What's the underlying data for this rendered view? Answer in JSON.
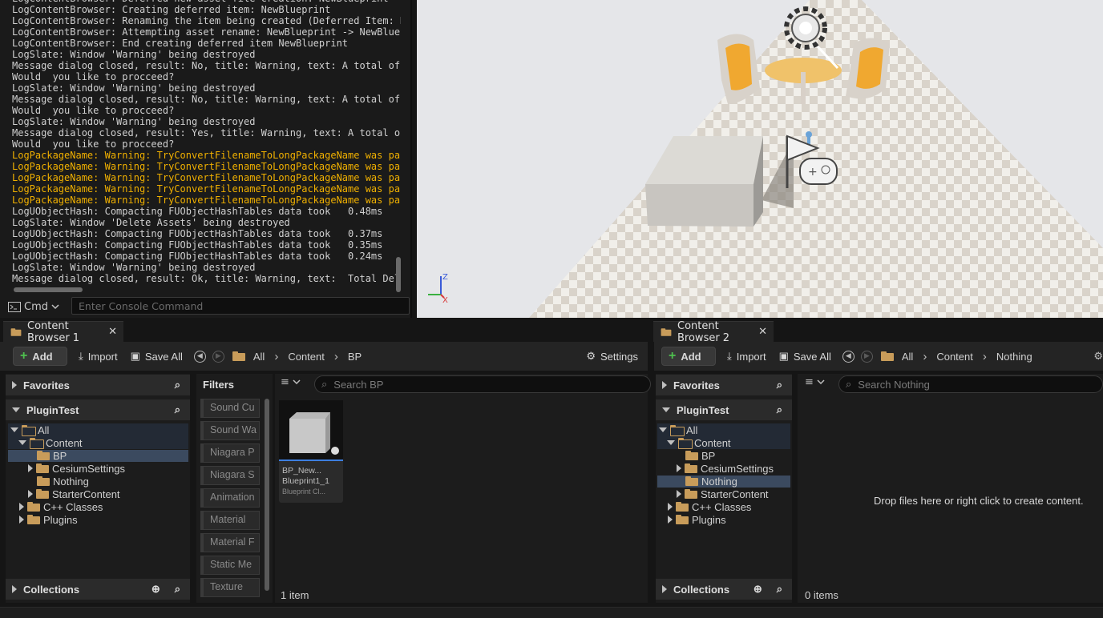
{
  "log": {
    "lines": [
      {
        "text": "LogContentBrowser: Deferred new asset file creation: NewBlueprint",
        "warn": false
      },
      {
        "text": "LogContentBrowser: Creating deferred item: NewBlueprint",
        "warn": false
      },
      {
        "text": "LogContentBrowser: Renaming the item being created (Deferred Item: N",
        "warn": false
      },
      {
        "text": "LogContentBrowser: Attempting asset rename: NewBlueprint -> NewBluep",
        "warn": false
      },
      {
        "text": "LogContentBrowser: End creating deferred item NewBlueprint",
        "warn": false
      },
      {
        "text": "LogSlate: Window 'Warning' being destroyed",
        "warn": false
      },
      {
        "text": "Message dialog closed, result: No, title: Warning, text: A total of",
        "warn": false
      },
      {
        "text": "Would  you like to procceed?",
        "warn": false
      },
      {
        "text": "LogSlate: Window 'Warning' being destroyed",
        "warn": false
      },
      {
        "text": "Message dialog closed, result: No, title: Warning, text: A total of",
        "warn": false
      },
      {
        "text": "Would  you like to procceed?",
        "warn": false
      },
      {
        "text": "LogSlate: Window 'Warning' being destroyed",
        "warn": false
      },
      {
        "text": "Message dialog closed, result: Yes, title: Warning, text: A total of",
        "warn": false
      },
      {
        "text": "Would  you like to procceed?",
        "warn": false
      },
      {
        "text": "LogPackageName: Warning: TryConvertFilenameToLongPackageName was pas",
        "warn": true
      },
      {
        "text": "LogPackageName: Warning: TryConvertFilenameToLongPackageName was pas",
        "warn": true
      },
      {
        "text": "LogPackageName: Warning: TryConvertFilenameToLongPackageName was pas",
        "warn": true
      },
      {
        "text": "LogPackageName: Warning: TryConvertFilenameToLongPackageName was pas",
        "warn": true
      },
      {
        "text": "LogPackageName: Warning: TryConvertFilenameToLongPackageName was pas",
        "warn": true
      },
      {
        "text": "LogUObjectHash: Compacting FUObjectHashTables data took   0.48ms",
        "warn": false
      },
      {
        "text": "LogSlate: Window 'Delete Assets' being destroyed",
        "warn": false
      },
      {
        "text": "LogUObjectHash: Compacting FUObjectHashTables data took   0.37ms",
        "warn": false
      },
      {
        "text": "LogUObjectHash: Compacting FUObjectHashTables data took   0.35ms",
        "warn": false
      },
      {
        "text": "LogUObjectHash: Compacting FUObjectHashTables data took   0.24ms",
        "warn": false
      },
      {
        "text": "LogSlate: Window 'Warning' being destroyed",
        "warn": false
      },
      {
        "text": "Message dialog closed, result: Ok, title: Warning, text:  Total Dele",
        "warn": false
      }
    ],
    "cmd_label": "Cmd",
    "cmd_placeholder": "Enter Console Command",
    "warn_color": "#f0b000"
  },
  "viewport": {
    "axis_z": "Z",
    "axis_x": "X"
  },
  "cb1": {
    "tab": "Content Browser 1",
    "add": "Add",
    "import": "Import",
    "save_all": "Save All",
    "path": [
      "All",
      "Content",
      "BP"
    ],
    "settings": "Settings",
    "favorites": "Favorites",
    "project": "PluginTest",
    "tree": [
      "All",
      "Content",
      "BP",
      "CesiumSettings",
      "Nothing",
      "StarterContent",
      "C++ Classes",
      "Plugins"
    ],
    "filters_title": "Filters",
    "filters": [
      "Sound Cu",
      "Sound Wa",
      "Niagara P",
      "Niagara S",
      "Animation",
      "Material",
      "Material F",
      "Static Me",
      "Texture"
    ],
    "search_placeholder": "Search BP",
    "asset": {
      "name1": "BP_New...",
      "name2": "Blueprint1_1",
      "type": "Blueprint Cl..."
    },
    "count": "1 item",
    "collections": "Collections"
  },
  "cb2": {
    "tab": "Content Browser 2",
    "add": "Add",
    "import": "Import",
    "save_all": "Save All",
    "path": [
      "All",
      "Content",
      "Nothing"
    ],
    "favorites": "Favorites",
    "project": "PluginTest",
    "tree": [
      "All",
      "Content",
      "BP",
      "CesiumSettings",
      "Nothing",
      "StarterContent",
      "C++ Classes",
      "Plugins"
    ],
    "search_placeholder": "Search Nothing",
    "empty_msg": "Drop files here or right click to create content.",
    "count": "0 items",
    "collections": "Collections"
  }
}
